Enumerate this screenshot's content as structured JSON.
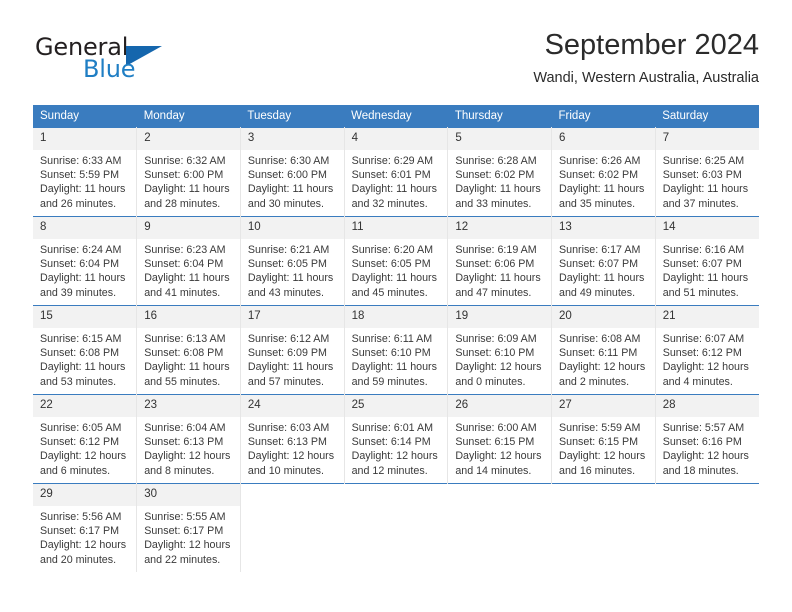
{
  "brand": {
    "name_part1": "General",
    "name_part2": "Blue",
    "accent_color": "#1566ad",
    "text_color": "#231f20"
  },
  "header": {
    "month_title": "September 2024",
    "location": "Wandi, Western Australia, Australia"
  },
  "calendar": {
    "header_color": "#3a7cbf",
    "weekdays": [
      "Sunday",
      "Monday",
      "Tuesday",
      "Wednesday",
      "Thursday",
      "Friday",
      "Saturday"
    ],
    "weeks": [
      [
        {
          "day": "1",
          "sunrise": "Sunrise: 6:33 AM",
          "sunset": "Sunset: 5:59 PM",
          "daylight": "Daylight: 11 hours and 26 minutes."
        },
        {
          "day": "2",
          "sunrise": "Sunrise: 6:32 AM",
          "sunset": "Sunset: 6:00 PM",
          "daylight": "Daylight: 11 hours and 28 minutes."
        },
        {
          "day": "3",
          "sunrise": "Sunrise: 6:30 AM",
          "sunset": "Sunset: 6:00 PM",
          "daylight": "Daylight: 11 hours and 30 minutes."
        },
        {
          "day": "4",
          "sunrise": "Sunrise: 6:29 AM",
          "sunset": "Sunset: 6:01 PM",
          "daylight": "Daylight: 11 hours and 32 minutes."
        },
        {
          "day": "5",
          "sunrise": "Sunrise: 6:28 AM",
          "sunset": "Sunset: 6:02 PM",
          "daylight": "Daylight: 11 hours and 33 minutes."
        },
        {
          "day": "6",
          "sunrise": "Sunrise: 6:26 AM",
          "sunset": "Sunset: 6:02 PM",
          "daylight": "Daylight: 11 hours and 35 minutes."
        },
        {
          "day": "7",
          "sunrise": "Sunrise: 6:25 AM",
          "sunset": "Sunset: 6:03 PM",
          "daylight": "Daylight: 11 hours and 37 minutes."
        }
      ],
      [
        {
          "day": "8",
          "sunrise": "Sunrise: 6:24 AM",
          "sunset": "Sunset: 6:04 PM",
          "daylight": "Daylight: 11 hours and 39 minutes."
        },
        {
          "day": "9",
          "sunrise": "Sunrise: 6:23 AM",
          "sunset": "Sunset: 6:04 PM",
          "daylight": "Daylight: 11 hours and 41 minutes."
        },
        {
          "day": "10",
          "sunrise": "Sunrise: 6:21 AM",
          "sunset": "Sunset: 6:05 PM",
          "daylight": "Daylight: 11 hours and 43 minutes."
        },
        {
          "day": "11",
          "sunrise": "Sunrise: 6:20 AM",
          "sunset": "Sunset: 6:05 PM",
          "daylight": "Daylight: 11 hours and 45 minutes."
        },
        {
          "day": "12",
          "sunrise": "Sunrise: 6:19 AM",
          "sunset": "Sunset: 6:06 PM",
          "daylight": "Daylight: 11 hours and 47 minutes."
        },
        {
          "day": "13",
          "sunrise": "Sunrise: 6:17 AM",
          "sunset": "Sunset: 6:07 PM",
          "daylight": "Daylight: 11 hours and 49 minutes."
        },
        {
          "day": "14",
          "sunrise": "Sunrise: 6:16 AM",
          "sunset": "Sunset: 6:07 PM",
          "daylight": "Daylight: 11 hours and 51 minutes."
        }
      ],
      [
        {
          "day": "15",
          "sunrise": "Sunrise: 6:15 AM",
          "sunset": "Sunset: 6:08 PM",
          "daylight": "Daylight: 11 hours and 53 minutes."
        },
        {
          "day": "16",
          "sunrise": "Sunrise: 6:13 AM",
          "sunset": "Sunset: 6:08 PM",
          "daylight": "Daylight: 11 hours and 55 minutes."
        },
        {
          "day": "17",
          "sunrise": "Sunrise: 6:12 AM",
          "sunset": "Sunset: 6:09 PM",
          "daylight": "Daylight: 11 hours and 57 minutes."
        },
        {
          "day": "18",
          "sunrise": "Sunrise: 6:11 AM",
          "sunset": "Sunset: 6:10 PM",
          "daylight": "Daylight: 11 hours and 59 minutes."
        },
        {
          "day": "19",
          "sunrise": "Sunrise: 6:09 AM",
          "sunset": "Sunset: 6:10 PM",
          "daylight": "Daylight: 12 hours and 0 minutes."
        },
        {
          "day": "20",
          "sunrise": "Sunrise: 6:08 AM",
          "sunset": "Sunset: 6:11 PM",
          "daylight": "Daylight: 12 hours and 2 minutes."
        },
        {
          "day": "21",
          "sunrise": "Sunrise: 6:07 AM",
          "sunset": "Sunset: 6:12 PM",
          "daylight": "Daylight: 12 hours and 4 minutes."
        }
      ],
      [
        {
          "day": "22",
          "sunrise": "Sunrise: 6:05 AM",
          "sunset": "Sunset: 6:12 PM",
          "daylight": "Daylight: 12 hours and 6 minutes."
        },
        {
          "day": "23",
          "sunrise": "Sunrise: 6:04 AM",
          "sunset": "Sunset: 6:13 PM",
          "daylight": "Daylight: 12 hours and 8 minutes."
        },
        {
          "day": "24",
          "sunrise": "Sunrise: 6:03 AM",
          "sunset": "Sunset: 6:13 PM",
          "daylight": "Daylight: 12 hours and 10 minutes."
        },
        {
          "day": "25",
          "sunrise": "Sunrise: 6:01 AM",
          "sunset": "Sunset: 6:14 PM",
          "daylight": "Daylight: 12 hours and 12 minutes."
        },
        {
          "day": "26",
          "sunrise": "Sunrise: 6:00 AM",
          "sunset": "Sunset: 6:15 PM",
          "daylight": "Daylight: 12 hours and 14 minutes."
        },
        {
          "day": "27",
          "sunrise": "Sunrise: 5:59 AM",
          "sunset": "Sunset: 6:15 PM",
          "daylight": "Daylight: 12 hours and 16 minutes."
        },
        {
          "day": "28",
          "sunrise": "Sunrise: 5:57 AM",
          "sunset": "Sunset: 6:16 PM",
          "daylight": "Daylight: 12 hours and 18 minutes."
        }
      ],
      [
        {
          "day": "29",
          "sunrise": "Sunrise: 5:56 AM",
          "sunset": "Sunset: 6:17 PM",
          "daylight": "Daylight: 12 hours and 20 minutes."
        },
        {
          "day": "30",
          "sunrise": "Sunrise: 5:55 AM",
          "sunset": "Sunset: 6:17 PM",
          "daylight": "Daylight: 12 hours and 22 minutes."
        },
        null,
        null,
        null,
        null,
        null
      ]
    ]
  }
}
